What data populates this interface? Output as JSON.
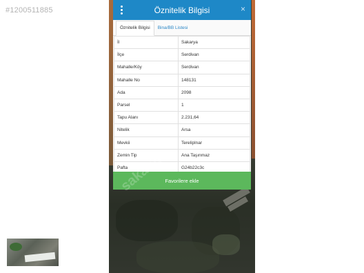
{
  "listing": {
    "id": "#1200511885"
  },
  "modal": {
    "title": "Öznitelik Bilgisi",
    "tabs": [
      {
        "label": "Öznitelik Bilgisi",
        "active": true
      },
      {
        "label": "Bina/BB Listesi",
        "active": false
      }
    ],
    "rows": [
      {
        "key": "İl",
        "value": "Sakarya"
      },
      {
        "key": "İlçe",
        "value": "Serdivan"
      },
      {
        "key": "Mahalle/Köy",
        "value": "Serdivan"
      },
      {
        "key": "Mahalle No",
        "value": "148131"
      },
      {
        "key": "Ada",
        "value": "2098"
      },
      {
        "key": "Parsel",
        "value": "1"
      },
      {
        "key": "Tapu Alanı",
        "value": "2.231,64"
      },
      {
        "key": "Nitelik",
        "value": "Arsa"
      },
      {
        "key": "Mevkii",
        "value": "Tereliplnar"
      },
      {
        "key": "Zemin Tip",
        "value": "Ana Taşınmaz"
      },
      {
        "key": "Pafta",
        "value": "G24b22c3c"
      }
    ],
    "favorite_button": "Favorilere ekle",
    "close_symbol": "×"
  },
  "watermark": "sakarya",
  "colors": {
    "header": "#1e88c7",
    "button": "#5cb85c",
    "tab_link": "#2a86c6"
  },
  "icons": {
    "menu": "vertical-dots-menu-icon",
    "close": "close-icon"
  }
}
